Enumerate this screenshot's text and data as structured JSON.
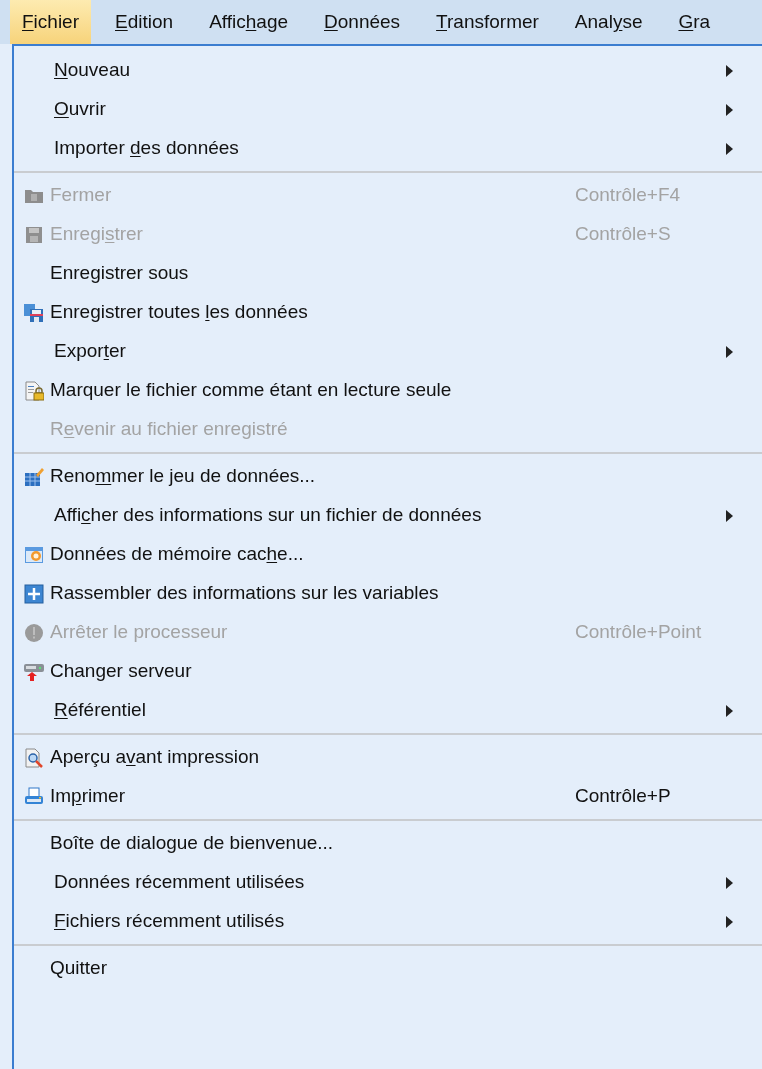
{
  "menu_bar": [
    {
      "label": [
        {
          "text": "F",
          "underlined": true
        },
        {
          "text": "ichier",
          "underlined": false
        }
      ],
      "selected": true
    },
    {
      "label": [
        {
          "text": "E",
          "underlined": true
        },
        {
          "text": "dition",
          "underlined": false
        }
      ],
      "selected": false
    },
    {
      "label": [
        {
          "text": "Affic",
          "underlined": false
        },
        {
          "text": "h",
          "underlined": true
        },
        {
          "text": "age",
          "underlined": false
        }
      ],
      "selected": false
    },
    {
      "label": [
        {
          "text": "D",
          "underlined": true
        },
        {
          "text": "onnées",
          "underlined": false
        }
      ],
      "selected": false
    },
    {
      "label": [
        {
          "text": "T",
          "underlined": true
        },
        {
          "text": "ransformer",
          "underlined": false
        }
      ],
      "selected": false
    },
    {
      "label": [
        {
          "text": "Anal",
          "underlined": false
        },
        {
          "text": "y",
          "underlined": true
        },
        {
          "text": "se",
          "underlined": false
        }
      ],
      "selected": false
    },
    {
      "label": [
        {
          "text": "G",
          "underlined": true
        },
        {
          "text": "ra",
          "underlined": false
        }
      ],
      "selected": false
    }
  ],
  "menu": {
    "items": [
      {
        "kind": "submenu",
        "disabled": false,
        "label": [
          {
            "text": "N",
            "underlined": true
          },
          {
            "text": "ouveau",
            "underlined": false
          }
        ]
      },
      {
        "kind": "submenu",
        "disabled": false,
        "label": [
          {
            "text": "O",
            "underlined": true
          },
          {
            "text": "uvrir",
            "underlined": false
          }
        ]
      },
      {
        "kind": "submenu",
        "disabled": false,
        "label": [
          {
            "text": "Importer ",
            "underlined": false
          },
          {
            "text": "d",
            "underlined": true
          },
          {
            "text": "es données",
            "underlined": false
          }
        ]
      },
      {
        "kind": "separator"
      },
      {
        "kind": "command",
        "disabled": true,
        "label": [
          {
            "text": "Fermer",
            "underlined": false
          }
        ],
        "shortcut": "Contrôle+F4"
      },
      {
        "kind": "command",
        "disabled": true,
        "label": [
          {
            "text": "Enregi",
            "underlined": false
          },
          {
            "text": "s",
            "underlined": true
          },
          {
            "text": "trer",
            "underlined": false
          }
        ],
        "shortcut": "Contrôle+S"
      },
      {
        "kind": "command",
        "disabled": false,
        "label": [
          {
            "text": "Enregistrer sous",
            "underlined": false
          }
        ]
      },
      {
        "kind": "command",
        "disabled": false,
        "label": [
          {
            "text": "Enregistrer toutes ",
            "underlined": false
          },
          {
            "text": "l",
            "underlined": true
          },
          {
            "text": "es données",
            "underlined": false
          }
        ]
      },
      {
        "kind": "submenu",
        "disabled": false,
        "label": [
          {
            "text": "Expor",
            "underlined": false
          },
          {
            "text": "t",
            "underlined": true
          },
          {
            "text": "er",
            "underlined": false
          }
        ]
      },
      {
        "kind": "command",
        "disabled": false,
        "label": [
          {
            "text": "Marquer le fichier comme étant en lecture seule",
            "underlined": false
          }
        ]
      },
      {
        "kind": "command",
        "disabled": true,
        "label": [
          {
            "text": "R",
            "underlined": false
          },
          {
            "text": "e",
            "underlined": true
          },
          {
            "text": "venir au fichier enregistré",
            "underlined": false
          }
        ]
      },
      {
        "kind": "separator"
      },
      {
        "kind": "command",
        "disabled": false,
        "label": [
          {
            "text": "Reno",
            "underlined": false
          },
          {
            "text": "m",
            "underlined": true
          },
          {
            "text": "mer le jeu de données...",
            "underlined": false
          }
        ]
      },
      {
        "kind": "submenu",
        "disabled": false,
        "label": [
          {
            "text": "Affi",
            "underlined": false
          },
          {
            "text": "c",
            "underlined": true
          },
          {
            "text": "her des informations sur un fichier de données",
            "underlined": false
          }
        ]
      },
      {
        "kind": "command",
        "disabled": false,
        "label": [
          {
            "text": "Données de mémoire cac",
            "underlined": false
          },
          {
            "text": "h",
            "underlined": true
          },
          {
            "text": "e...",
            "underlined": false
          }
        ]
      },
      {
        "kind": "command",
        "disabled": false,
        "label": [
          {
            "text": "Rassembler des informations sur les variables",
            "underlined": false
          }
        ]
      },
      {
        "kind": "command",
        "disabled": true,
        "label": [
          {
            "text": "Arrêter le processeur",
            "underlined": false
          }
        ],
        "shortcut": "Contrôle+Point"
      },
      {
        "kind": "command",
        "disabled": false,
        "label": [
          {
            "text": "Changer serveur",
            "underlined": false
          }
        ]
      },
      {
        "kind": "submenu",
        "disabled": false,
        "label": [
          {
            "text": "R",
            "underlined": true
          },
          {
            "text": "éférentiel",
            "underlined": false
          }
        ]
      },
      {
        "kind": "separator"
      },
      {
        "kind": "command",
        "disabled": false,
        "label": [
          {
            "text": "Aperçu a",
            "underlined": false
          },
          {
            "text": "v",
            "underlined": true
          },
          {
            "text": "ant impression",
            "underlined": false
          }
        ]
      },
      {
        "kind": "command",
        "disabled": false,
        "label": [
          {
            "text": "Im",
            "underlined": false
          },
          {
            "text": "p",
            "underlined": true
          },
          {
            "text": "rimer",
            "underlined": false
          }
        ],
        "shortcut": "Contrôle+P"
      },
      {
        "kind": "separator"
      },
      {
        "kind": "command",
        "disabled": false,
        "label": [
          {
            "text": "Boîte de dialogue de bienvenue...",
            "underlined": false
          }
        ]
      },
      {
        "kind": "submenu",
        "disabled": false,
        "label": [
          {
            "text": "Données récemment utilisées",
            "underlined": false
          }
        ]
      },
      {
        "kind": "submenu",
        "disabled": false,
        "label": [
          {
            "text": "F",
            "underlined": true
          },
          {
            "text": "ichiers récemment utilisés",
            "underlined": false
          }
        ]
      },
      {
        "kind": "separator"
      },
      {
        "kind": "command",
        "disabled": false,
        "label": [
          {
            "text": "Quitter",
            "underlined": false
          }
        ]
      }
    ]
  }
}
